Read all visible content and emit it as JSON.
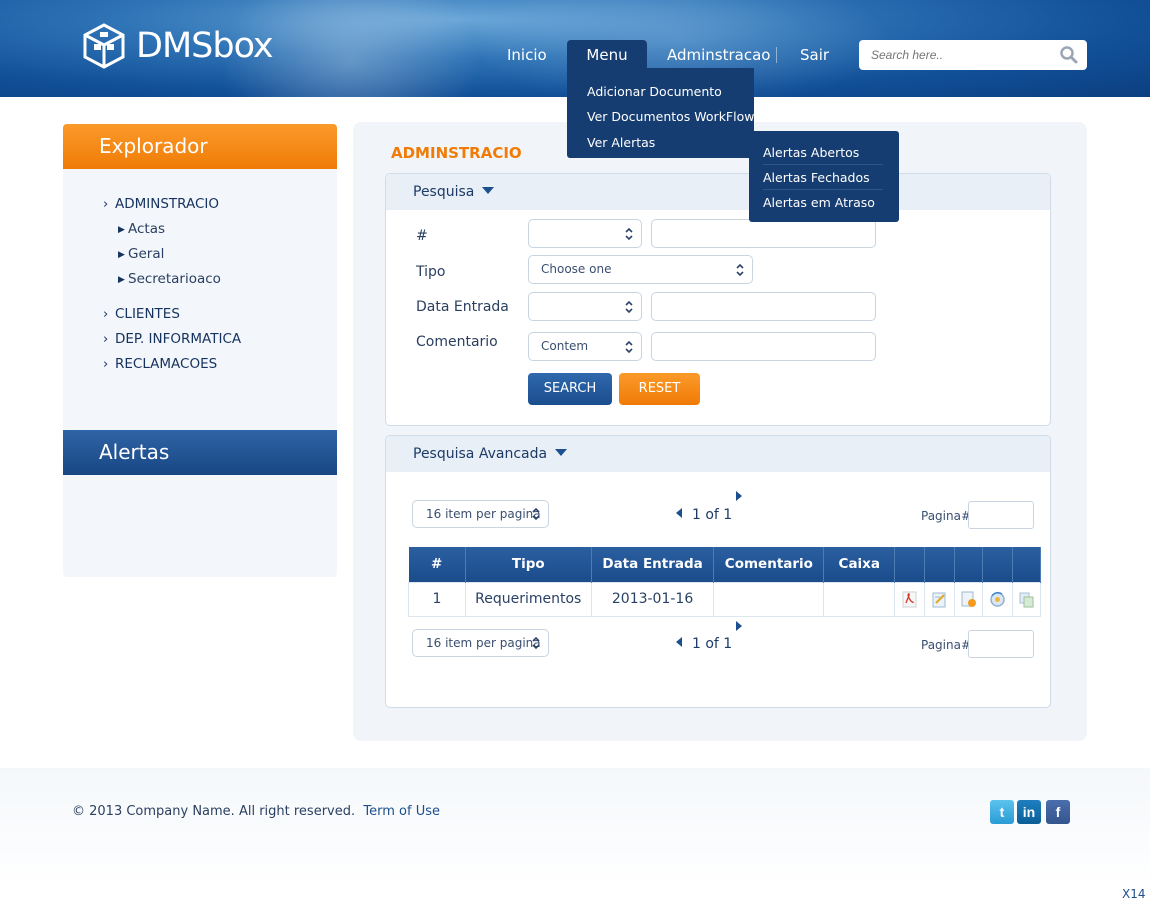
{
  "brand": {
    "name": "DMSbox"
  },
  "nav": {
    "items": [
      "Inicio",
      "Menu",
      "Adminstracao",
      "Sair"
    ],
    "active": "Menu"
  },
  "search": {
    "placeholder": "Search here.."
  },
  "menu_dropdown": {
    "items": [
      "Adicionar Documento",
      "Ver Documentos WorkFlow",
      "Ver Alertas"
    ],
    "submenu": [
      "Alertas Abertos",
      "Alertas Fechados",
      "Alertas em Atraso"
    ]
  },
  "sidebar": {
    "explorer_title": "Explorador",
    "tree": [
      {
        "label": "ADMINSTRACIO",
        "children": [
          "Actas",
          "Geral",
          "Secretarioaco"
        ]
      },
      {
        "label": "CLIENTES"
      },
      {
        "label": "DEP. INFORMATICA"
      },
      {
        "label": "RECLAMACOES"
      }
    ],
    "alerts_title": "Alertas"
  },
  "main": {
    "title": "ADMINSTRACIO",
    "search_box": {
      "title": "Pesquisa",
      "fields": [
        {
          "label": "#"
        },
        {
          "label": "Tipo",
          "select_value": "Choose one"
        },
        {
          "label": "Data Entrada"
        },
        {
          "label": "Comentario",
          "select_value": "Contem"
        }
      ],
      "search_button": "SEARCH",
      "reset_button": "RESET"
    },
    "advanced_box": {
      "title": "Pesquisa Avancada",
      "pager": {
        "per_page": "16 item per pagina",
        "page_info": "1 of 1",
        "page_label": "Pagina#"
      },
      "table": {
        "columns": [
          "#",
          "Tipo",
          "Data Entrada",
          "Comentario",
          "Caixa"
        ],
        "rows": [
          {
            "num": "1",
            "tipo": "Requerimentos",
            "data": "2013-01-16",
            "comentario": "",
            "caixa": ""
          }
        ],
        "action_icons": [
          "pdf-icon",
          "edit-document-icon",
          "document-alert-icon",
          "settings-cycle-icon",
          "copy-icon"
        ]
      }
    }
  },
  "footer": {
    "copyright": "© 2013 Company Name.  All right reserved.",
    "term_link": "Term of Use",
    "social": [
      "twitter-icon",
      "linkedin-icon",
      "facebook-icon"
    ]
  },
  "page_code": "X14",
  "colors": {
    "accent": "#f07b06",
    "primary": "#1a4d8e",
    "header": "#114f97"
  }
}
